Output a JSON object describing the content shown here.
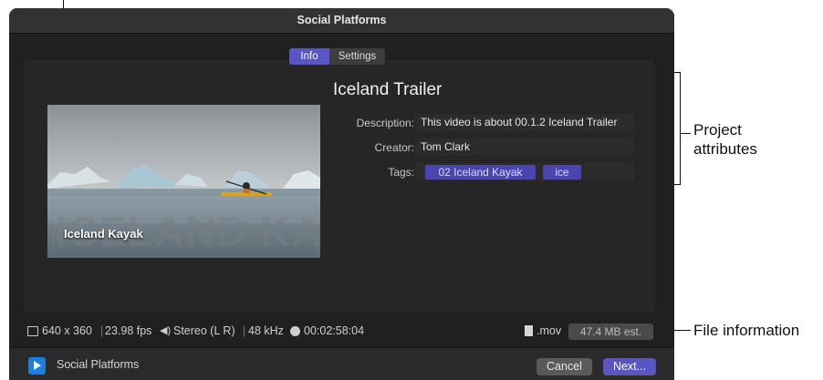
{
  "dialog": {
    "title": "Social Platforms",
    "tabs": [
      {
        "label": "Info",
        "active": true
      },
      {
        "label": "Settings",
        "active": false
      }
    ],
    "project_title": "Iceland Trailer",
    "thumbnail": {
      "caption": "Iceland Kayak",
      "overlay_text": "ICELAND KAYAK"
    },
    "attributes": {
      "description_label": "Description:",
      "description_value": "This video is about 00.1.2 Iceland Trailer",
      "creator_label": "Creator:",
      "creator_value": "Tom Clark",
      "tags_label": "Tags:",
      "tags": [
        "02 Iceland Kayak",
        "ice"
      ]
    },
    "file_info": {
      "resolution": "640 x 360",
      "frame_rate": "23.98 fps",
      "audio_channels": "Stereo (L R)",
      "sample_rate": "48 kHz",
      "duration": "00:02:58:04",
      "extension": ".mov",
      "size_estimate": "47.4 MB est."
    },
    "footer": {
      "destination": "Social Platforms",
      "cancel_label": "Cancel",
      "next_label": "Next..."
    }
  },
  "callouts": {
    "project_attributes": "Project attributes",
    "file_information": "File information"
  },
  "colors": {
    "accent": "#5a55c4",
    "tag_bg": "#4a45b0",
    "dialog_bg": "#202020"
  }
}
